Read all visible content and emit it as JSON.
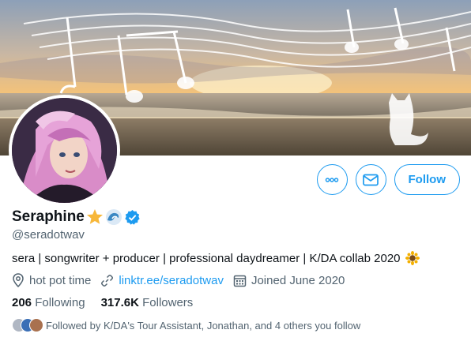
{
  "profile": {
    "name": "Seraphine",
    "handle": "@seradotwav",
    "bio": "sera | songwriter + producer | professional daydreamer | K/DA collab 2020",
    "location": "hot pot time",
    "website": "linktr.ee/seradotwav",
    "joined": "Joined June 2020",
    "following_count": "206",
    "following_label": "Following",
    "followers_count": "317.6K",
    "followers_label": "Followers",
    "followed_by": "Followed by K/DA's Tour Assistant, Jonathan, and 4 others you follow"
  },
  "actions": {
    "more": "more-icon",
    "message": "mail-icon",
    "follow_label": "Follow"
  },
  "colors": {
    "accent": "#1d9bf0",
    "text": "#0f1419",
    "muted": "#536471"
  },
  "icons": [
    "star-emoji",
    "wave-emoji",
    "verified-badge-icon",
    "sunflower-emoji",
    "location-icon",
    "link-icon",
    "calendar-icon"
  ]
}
